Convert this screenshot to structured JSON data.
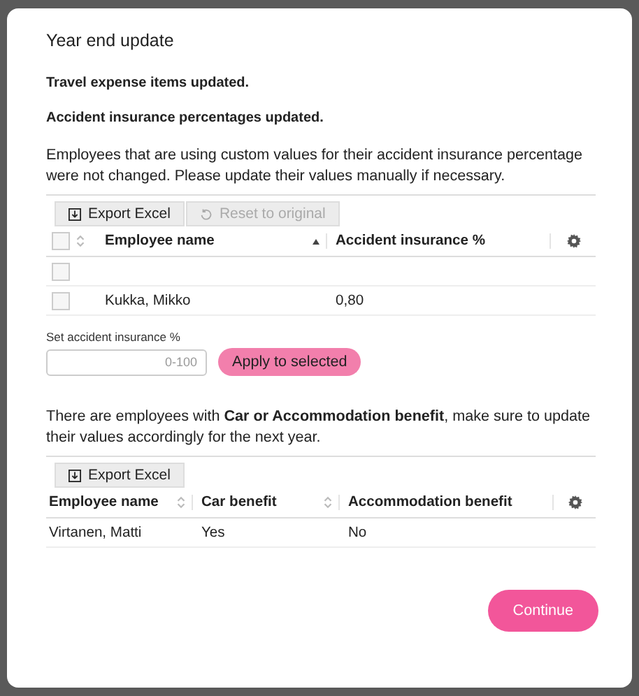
{
  "dialog": {
    "title": "Year end update",
    "messages": [
      "Travel expense items updated.",
      "Accident insurance percentages updated."
    ],
    "custom_note": "Employees that are using custom values for their accident insurance percentage were not changed. Please update their values manually if necessary.",
    "insurance_table": {
      "toolbar": [
        {
          "label": "Export Excel",
          "kind": "export",
          "disabled": false
        },
        {
          "label": "Reset to original",
          "kind": "reset",
          "disabled": true
        }
      ],
      "select_all": {
        "checked": false,
        "sortable": true,
        "sorted": false
      },
      "columns": [
        {
          "label": "Employee name",
          "sortable": true,
          "sorted": true
        },
        {
          "label": "Accident insurance %"
        }
      ],
      "rows": [
        {
          "checked": false
        },
        {
          "checked": false,
          "cells": [
            "Kukka, Mikko",
            "0,80"
          ]
        }
      ]
    },
    "set_field": {
      "label": "Set accident insurance %",
      "placeholder": "0-100"
    },
    "apply_button": {
      "label": "Apply to selected",
      "kind": "secondary"
    },
    "benefit_note": "There are employees with **Car or Accommodation benefit**, make sure to update their values accordingly for the next year.",
    "benefit_table": {
      "toolbar": [
        {
          "label": "Export Excel",
          "kind": "export",
          "disabled": false
        }
      ],
      "columns": [
        {
          "label": "Employee name",
          "sortable": true,
          "sorted": false
        },
        {
          "label": "Car benefit",
          "sortable": true,
          "sorted": false
        },
        {
          "label": "Accommodation benefit"
        }
      ],
      "rows": [
        {
          "cells": [
            "Virtanen, Matti",
            "Yes",
            "No"
          ]
        }
      ]
    },
    "continue_button": {
      "label": "Continue",
      "kind": "primary"
    }
  }
}
